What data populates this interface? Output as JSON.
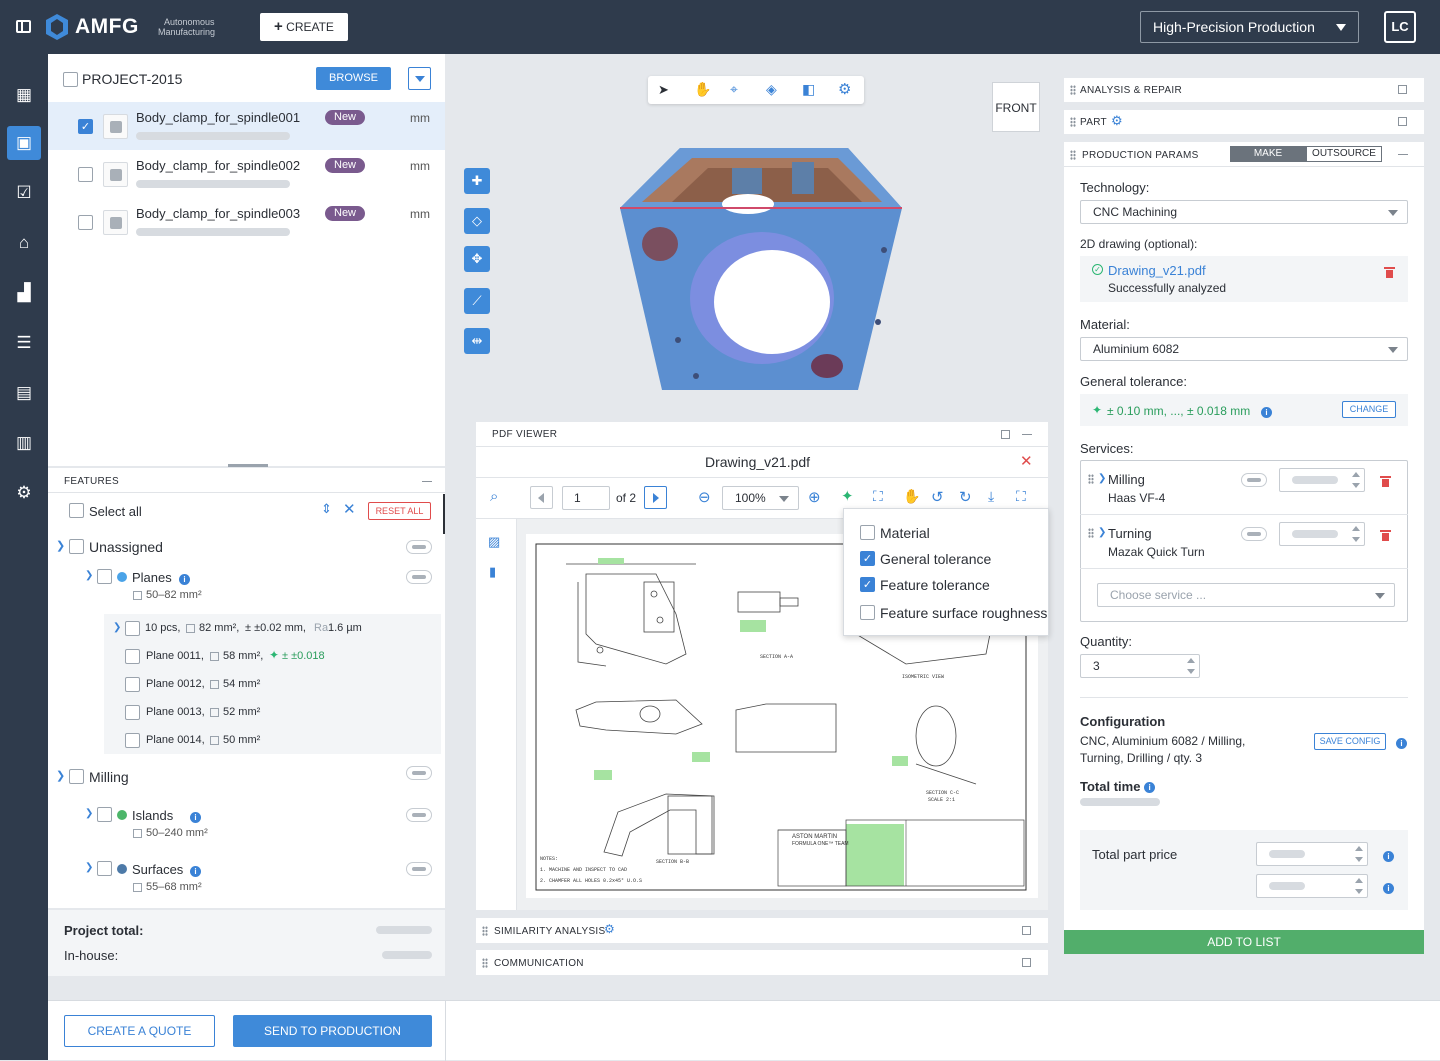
{
  "header": {
    "brand": "AMFG",
    "tagline_1": "Autonomous",
    "tagline_2": "Manufacturing",
    "create_label": "CREATE",
    "workspace": "High-Precision Production",
    "user_initials": "LC"
  },
  "project": {
    "name": "PROJECT-2015",
    "browse_label": "BROWSE",
    "parts": [
      {
        "name": "Body_clamp_for_spindle001",
        "badge": "New",
        "unit": "mm",
        "checked": true
      },
      {
        "name": "Body_clamp_for_spindle002",
        "badge": "New",
        "unit": "mm",
        "checked": false
      },
      {
        "name": "Body_clamp_for_spindle003",
        "badge": "New",
        "unit": "mm",
        "checked": false
      }
    ]
  },
  "features": {
    "title": "FEATURES",
    "select_all": "Select all",
    "reset_all": "RESET ALL",
    "unassigned": "Unassigned",
    "planes": "Planes",
    "planes_area": "50–82 mm²",
    "group_count": "10 pcs,",
    "group_area": "82 mm²,",
    "group_tol": "± ±0.02 mm,",
    "group_ra_label": "Ra",
    "group_ra": "1.6 µm",
    "plane_rows": [
      {
        "name": "Plane 0011,",
        "area": "58 mm²,",
        "tol": "± ±0.018"
      },
      {
        "name": "Plane 0012,",
        "area": "54 mm²",
        "tol": ""
      },
      {
        "name": "Plane 0013,",
        "area": "52 mm²",
        "tol": ""
      },
      {
        "name": "Plane 0014,",
        "area": "50 mm²",
        "tol": ""
      }
    ],
    "milling": "Milling",
    "islands": "Islands",
    "islands_area": "50–240 mm²",
    "surfaces": "Surfaces",
    "surfaces_area": "55–68 mm²",
    "project_total": "Project total:",
    "in_house": "In-house:"
  },
  "footer": {
    "create_quote": "CREATE A QUOTE",
    "send_production": "SEND TO PRODUCTION"
  },
  "viewer": {
    "front_label": "FRONT"
  },
  "pdf": {
    "title": "PDF VIEWER",
    "file": "Drawing_v21.pdf",
    "page": "1",
    "of": "of 2",
    "zoom": "100%",
    "menu": [
      {
        "label": "Material",
        "checked": false
      },
      {
        "label": "General tolerance",
        "checked": true
      },
      {
        "label": "Feature tolerance",
        "checked": true
      },
      {
        "label": "Feature surface roughness",
        "checked": false
      }
    ],
    "brand_text": "ASTON MARTIN",
    "brand_sub": "FORMULA ONE™ TEAM",
    "section_aa": "SECTION A-A",
    "section_bb": "SECTION B-B",
    "section_cc": "SECTION C-C",
    "scale": "SCALE 2:1",
    "iso": "ISOMETRIC VIEW",
    "notes_1": "NOTES:",
    "notes_2": "1. MACHINE AND INSPECT TO CAD",
    "notes_3": "2. CHAMFER ALL HOLES 0.2x45° U.O.S"
  },
  "similarity": "SIMILARITY ANALYSIS",
  "communication": "COMMUNICATION",
  "right": {
    "analysis": "ANALYSIS & REPAIR",
    "part": "PART",
    "params": "PRODUCTION PARAMS",
    "make": "MAKE",
    "outsource": "OUTSOURCE",
    "technology_label": "Technology:",
    "technology": "CNC Machining",
    "drawing_label": "2D drawing (optional):",
    "drawing_file": "Drawing_v21.pdf",
    "drawing_status": "Successfully analyzed",
    "material_label": "Material:",
    "material": "Aluminium 6082",
    "tolerance_label": "General tolerance:",
    "tolerance": "± 0.10 mm, ..., ± 0.018 mm",
    "change": "CHANGE",
    "services_label": "Services:",
    "services": [
      {
        "name": "Milling",
        "machine": "Haas VF-4"
      },
      {
        "name": "Turning",
        "machine": "Mazak Quick Turn"
      }
    ],
    "choose_service": "Choose service ...",
    "quantity_label": "Quantity:",
    "quantity": "3",
    "config_label": "Configuration",
    "config_1": "CNC, Aluminium 6082 / Milling,",
    "config_2": "Turning, Drilling / qty. 3",
    "save_config": "SAVE CONFIG",
    "total_time": "Total time",
    "total_price": "Total part price",
    "add_to_list": "ADD TO LIST"
  }
}
